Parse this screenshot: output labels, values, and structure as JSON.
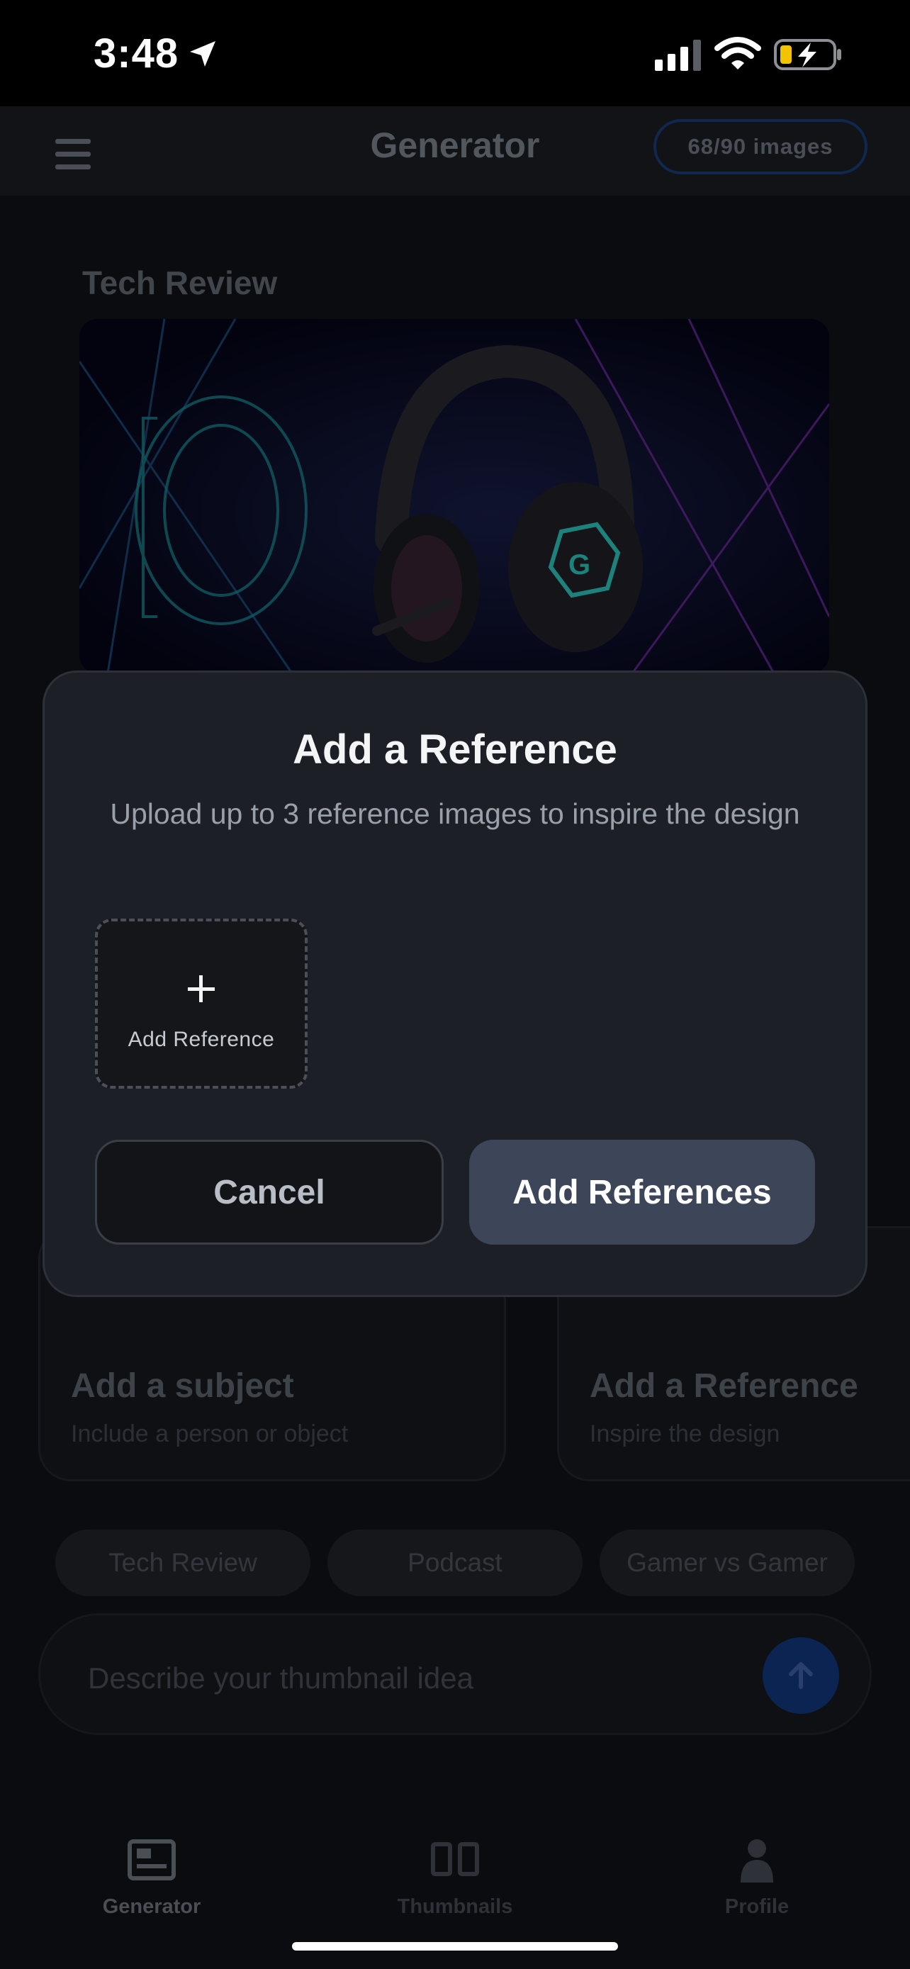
{
  "status_bar": {
    "time": "3:48"
  },
  "header": {
    "title": "Generator",
    "quota": "68/90 images"
  },
  "main": {
    "section_title": "Tech Review",
    "cards": [
      {
        "title": "Add a subject",
        "subtitle": "Include a person or object"
      },
      {
        "title": "Add a Reference",
        "subtitle": "Inspire the design"
      }
    ],
    "chips": [
      "Tech Review",
      "Podcast",
      "Gamer vs Gamer"
    ],
    "prompt_placeholder": "Describe your thumbnail idea"
  },
  "modal": {
    "title": "Add a Reference",
    "description": "Upload up to 3 reference images to inspire the design",
    "slot_label": "Add Reference",
    "cancel_label": "Cancel",
    "confirm_label": "Add References"
  },
  "tabs": [
    {
      "label": "Generator"
    },
    {
      "label": "Thumbnails"
    },
    {
      "label": "Profile"
    }
  ],
  "colors": {
    "modal_bg": "#1c1f25",
    "confirm_bg": "#3d4658",
    "accent_blue": "#0c2452"
  }
}
